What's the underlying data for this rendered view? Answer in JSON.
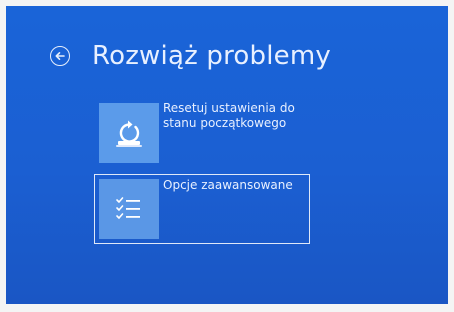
{
  "header": {
    "title": "Rozwiąż problemy",
    "back_icon": "arrow-left-circle-icon"
  },
  "options": [
    {
      "icon": "reset-pc-icon",
      "label": "Resetuj ustawienia do stanu początkowego"
    },
    {
      "icon": "checklist-icon",
      "label": "Opcje zaawansowane"
    }
  ],
  "colors": {
    "background": "#1b5fd2",
    "tile": "#5b9bea",
    "text": "#e8f0ff"
  }
}
